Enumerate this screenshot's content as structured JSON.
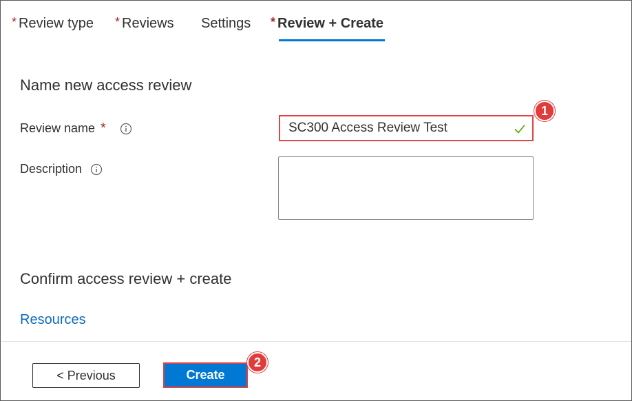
{
  "tabs": [
    {
      "label": "Review type",
      "required": true,
      "active": false
    },
    {
      "label": "Reviews",
      "required": true,
      "active": false
    },
    {
      "label": "Settings",
      "required": false,
      "active": false
    },
    {
      "label": "Review + Create",
      "required": true,
      "active": true
    }
  ],
  "required_marker": "*",
  "sections": {
    "name_title": "Name new access review",
    "confirm_title": "Confirm access review + create"
  },
  "form": {
    "review_name_label": "Review name",
    "review_name_value": "SC300 Access Review Test",
    "description_label": "Description",
    "description_value": ""
  },
  "links": {
    "resources": "Resources"
  },
  "footer": {
    "previous_label": "< Previous",
    "create_label": "Create"
  },
  "annotations": {
    "step1": "1",
    "step2": "2"
  },
  "icons": {
    "info": "info-icon",
    "valid": "checkmark-icon"
  },
  "colors": {
    "accent": "#0078d4",
    "required": "#a4262c",
    "highlight": "#e04444",
    "valid": "#57a300",
    "link": "#0f6cbd"
  }
}
